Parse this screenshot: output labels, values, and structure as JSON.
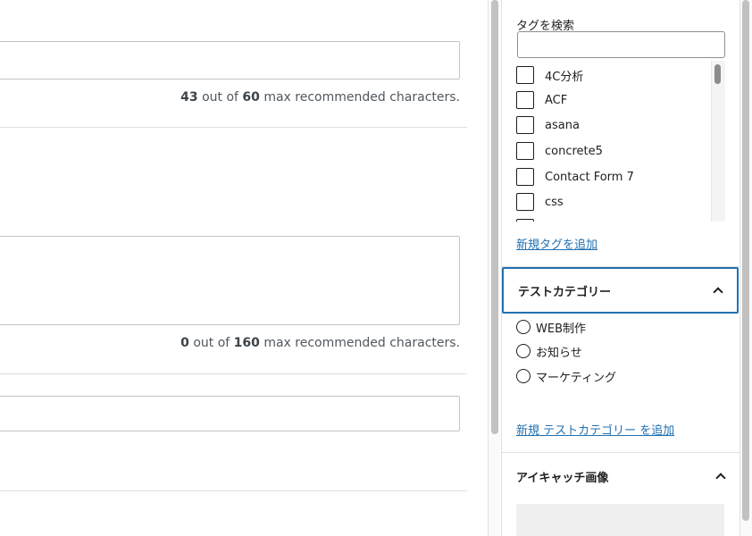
{
  "main": {
    "title_counter": {
      "current": "43",
      "mid": " out of ",
      "max": "60",
      "suffix": " max recommended characters."
    },
    "description_counter": {
      "current": "0",
      "mid": " out of ",
      "max": "160",
      "suffix": " max recommended characters."
    }
  },
  "sidebar": {
    "tags": {
      "search_label": "タグを検索",
      "items": [
        "4C分析",
        "ACF",
        "asana",
        "concrete5",
        "Contact Form 7",
        "css"
      ],
      "add_link": "新規タグを追加"
    },
    "test_category": {
      "title": "テストカテゴリー",
      "options": [
        "WEB制作",
        "お知らせ",
        "マーケティング"
      ],
      "add_link": "新規 テストカテゴリー を追加"
    },
    "featured_image": {
      "title": "アイキャッチ画像"
    }
  },
  "colors": {
    "accent": "#2271b1",
    "border": "#c3c4c7"
  }
}
